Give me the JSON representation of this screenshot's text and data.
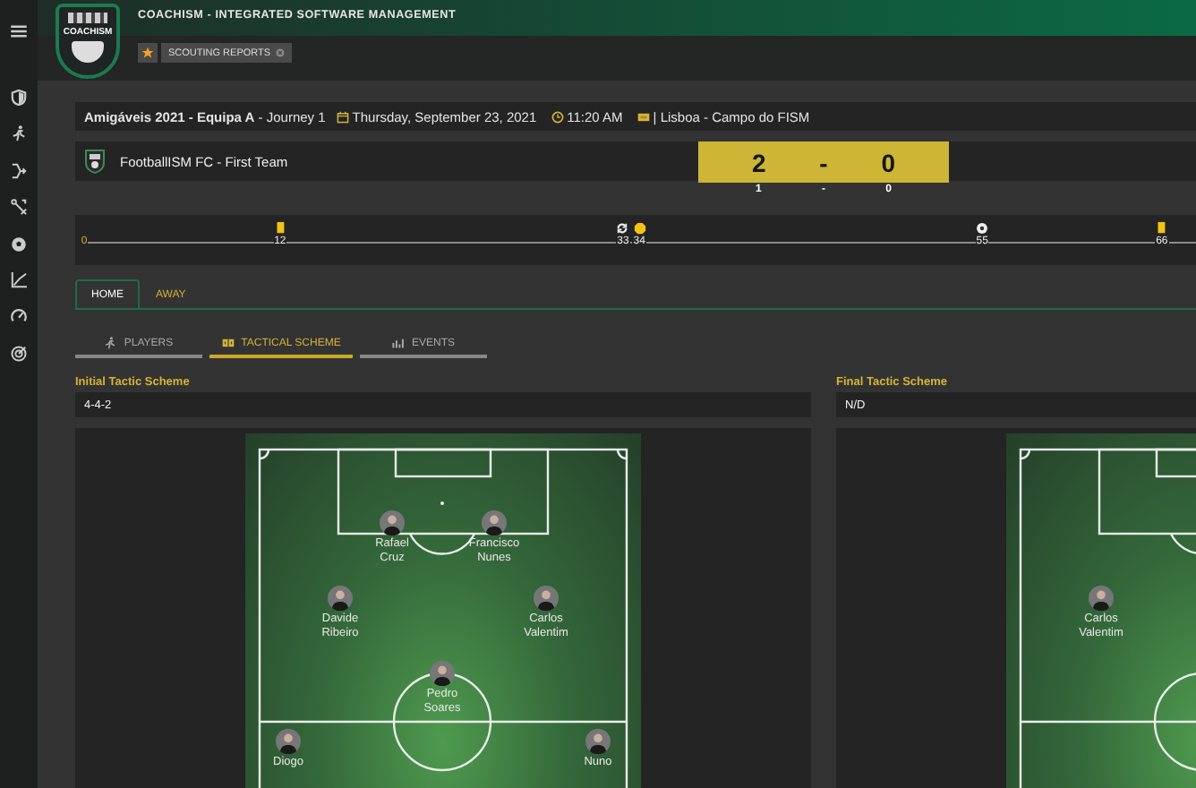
{
  "header": {
    "logo_text": "COACH**ISM**",
    "title": "COACH**ISM** - INTEGRATED SOFTWARE MANAGEMENT",
    "breadcrumb": "SCOUTING REPORTS"
  },
  "match": {
    "competition": "**Amigáveis 2021 - Equipa A** - Journey 1",
    "date": "Thursday, September 23, 2021",
    "time": "11:20 AM",
    "venue": "| Lisboa - Campo do FISM"
  },
  "team": {
    "name": "FootballISM FC - First Team",
    "score": [
      "2",
      "-",
      "0"
    ],
    "half_time": [
      "1",
      "-",
      "0"
    ]
  },
  "timeline": [
    {
      "kind": "start",
      "minute": "0"
    },
    {
      "kind": "yellow_card",
      "minute": "12"
    },
    {
      "kind": "substitution",
      "minute": "33"
    },
    {
      "kind": "badge",
      "minute": "34"
    },
    {
      "kind": "goal",
      "minute": "55"
    },
    {
      "kind": "yellow_card",
      "minute": "66"
    }
  ],
  "tabs": [
    {
      "label": "HOME",
      "selected": true
    },
    {
      "label": "AWAY",
      "selected": false
    }
  ],
  "subtabs": [
    {
      "kind": "players",
      "label": "PLAYERS",
      "selected": false
    },
    {
      "kind": "tactics",
      "label": "TACTICAL SCHEME",
      "selected": true
    },
    {
      "kind": "events",
      "label": "EVENTS",
      "selected": false
    }
  ],
  "schemes": [
    {
      "label": "Initial Tactic Scheme",
      "value": "4-4-2",
      "lines": [
        {
          "kind": "forwards",
          "players": [
            "Rafael Cruz",
            "Francisco Nunes"
          ]
        },
        {
          "kind": "midfield",
          "players": [
            "Davide Ribeiro",
            "Carlos Valentim"
          ]
        },
        {
          "kind": "center",
          "players": [
            "Pedro Soares"
          ]
        },
        {
          "kind": "defence",
          "players": [
            "Diogo",
            "Nuno"
          ]
        }
      ]
    },
    {
      "label": "Final Tactic Scheme",
      "value": "N/D",
      "lines": [
        {
          "kind": "midfield",
          "players": [
            "Carlos Valentim"
          ]
        }
      ]
    }
  ]
}
